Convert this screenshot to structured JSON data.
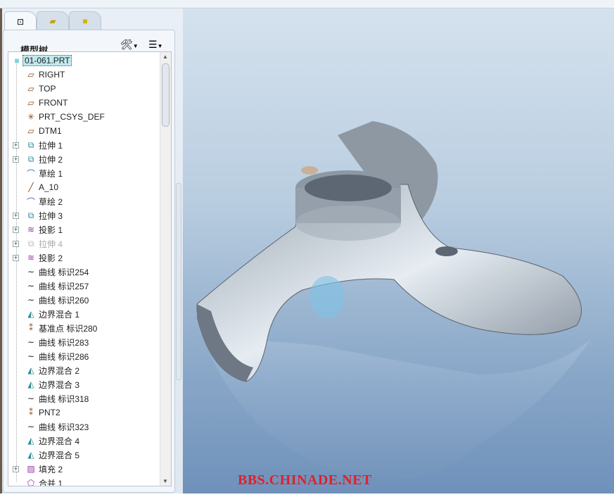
{
  "panel": {
    "title": "模型树",
    "tabs": [
      "model-tree",
      "layers",
      "folder"
    ]
  },
  "tree": [
    {
      "label": "01-061.PRT",
      "icon": "part",
      "root": true
    },
    {
      "label": "RIGHT",
      "icon": "plane"
    },
    {
      "label": "TOP",
      "icon": "plane"
    },
    {
      "label": "FRONT",
      "icon": "plane"
    },
    {
      "label": "PRT_CSYS_DEF",
      "icon": "csys"
    },
    {
      "label": "DTM1",
      "icon": "plane"
    },
    {
      "label": "拉伸 1",
      "icon": "extrude",
      "exp": true
    },
    {
      "label": "拉伸 2",
      "icon": "extrude",
      "exp": true
    },
    {
      "label": "草绘 1",
      "icon": "sketch"
    },
    {
      "label": "A_10",
      "icon": "axis"
    },
    {
      "label": "草绘 2",
      "icon": "sketch"
    },
    {
      "label": "拉伸 3",
      "icon": "extrude",
      "exp": true
    },
    {
      "label": "投影 1",
      "icon": "projection",
      "exp": true
    },
    {
      "label": "拉伸 4",
      "icon": "extrude",
      "exp": true,
      "dim": true
    },
    {
      "label": "投影 2",
      "icon": "projection",
      "exp": true
    },
    {
      "label": "曲线 标识254",
      "icon": "curve"
    },
    {
      "label": "曲线 标识257",
      "icon": "curve"
    },
    {
      "label": "曲线 标识260",
      "icon": "curve"
    },
    {
      "label": "边界混合 1",
      "icon": "boundary-blend"
    },
    {
      "label": "基准点 标识280",
      "icon": "datum-point"
    },
    {
      "label": "曲线 标识283",
      "icon": "curve"
    },
    {
      "label": "曲线 标识286",
      "icon": "curve"
    },
    {
      "label": "边界混合 2",
      "icon": "boundary-blend"
    },
    {
      "label": "边界混合 3",
      "icon": "boundary-blend"
    },
    {
      "label": "曲线 标识318",
      "icon": "curve"
    },
    {
      "label": "PNT2",
      "icon": "datum-point"
    },
    {
      "label": "曲线 标识323",
      "icon": "curve"
    },
    {
      "label": "边界混合 4",
      "icon": "boundary-blend"
    },
    {
      "label": "边界混合 5",
      "icon": "boundary-blend"
    },
    {
      "label": "填充 2",
      "icon": "fill",
      "exp": true
    },
    {
      "label": "合并 1",
      "icon": "merge"
    }
  ],
  "watermark": "BBS.CHINADE.NET"
}
